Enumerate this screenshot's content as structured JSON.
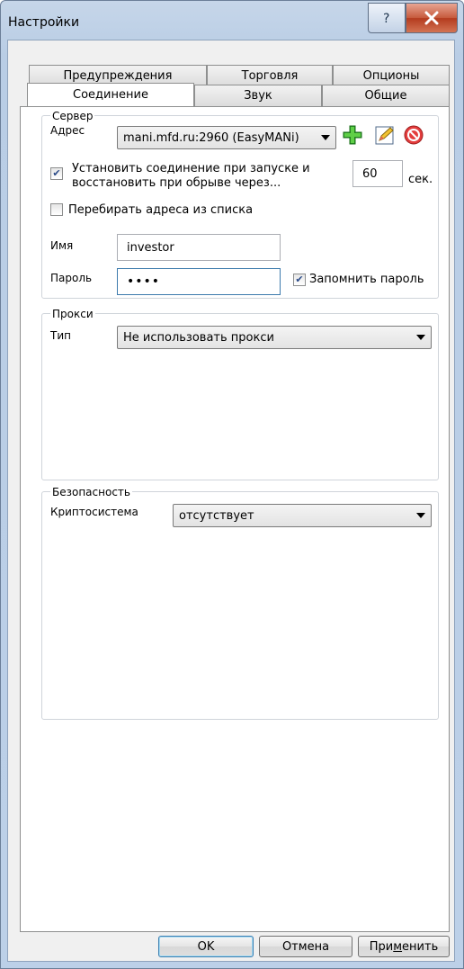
{
  "window": {
    "title": "Настройки"
  },
  "tabs": {
    "row_back": [
      "Предупреждения",
      "Торговля",
      "Опционы"
    ],
    "row_front": [
      "Соединение",
      "Звук",
      "Общие"
    ],
    "active": "Соединение"
  },
  "server": {
    "group_label": "Сервер",
    "address_label": "Адрес",
    "address_value": "mani.mfd.ru:2960 (EasyMANi)",
    "add_icon": "plus-icon",
    "edit_icon": "edit-icon",
    "delete_icon": "delete-icon",
    "reconnect_label_line1": "Установить соединение при запуске и",
    "reconnect_label_line2": "восстановить при обрыве через...",
    "reconnect_checked": true,
    "reconnect_seconds": "60",
    "seconds_unit": "сек.",
    "cycle_label": "Перебирать адреса из списка",
    "cycle_checked": false,
    "name_label": "Имя",
    "name_value": "investor",
    "password_label": "Пароль",
    "password_value": "••••",
    "remember_label": "Запомнить пароль",
    "remember_checked": true
  },
  "proxy": {
    "group_label": "Прокси",
    "type_label": "Тип",
    "type_value": "Не использовать прокси"
  },
  "security": {
    "group_label": "Безопасность",
    "crypto_label": "Криптосистема",
    "crypto_value": "отсутствует"
  },
  "buttons": {
    "ok": "OK",
    "cancel": "Отмена",
    "apply_pre": "При",
    "apply_underlined": "м",
    "apply_post": "енить"
  },
  "colors": {
    "titlebar": "#b9cde5",
    "close_button": "#c65a3c",
    "check_mark": "#2a4a88"
  }
}
